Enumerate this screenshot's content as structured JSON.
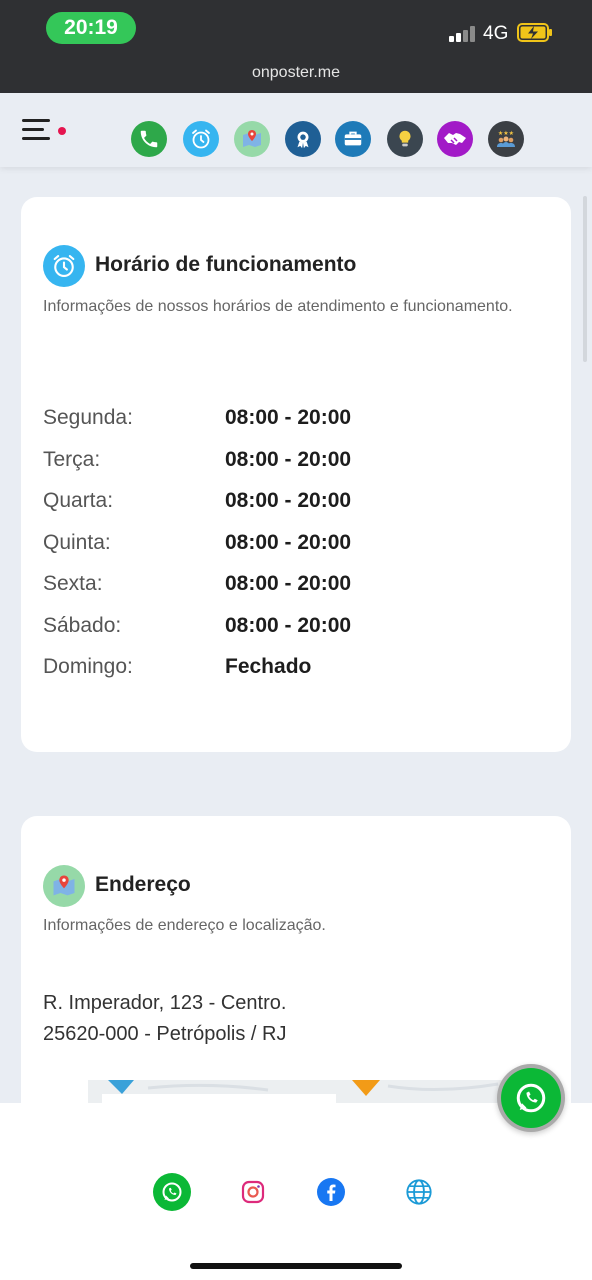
{
  "status_bar": {
    "time": "20:19",
    "network": "4G",
    "url": "onposter.me",
    "icons": [
      "signal-icon",
      "battery-charging-icon"
    ]
  },
  "header": {
    "menu_icon": "hamburger-menu-icon",
    "categories": [
      {
        "name": "phone-icon",
        "color": "#2ea84a"
      },
      {
        "name": "alarm-clock-icon",
        "color": "#36b5f0"
      },
      {
        "name": "map-pin-icon",
        "color": "#96d9a8"
      },
      {
        "name": "award-badge-icon",
        "color": "#1f5f95"
      },
      {
        "name": "briefcase-icon",
        "color": "#1e7ab8"
      },
      {
        "name": "lightbulb-icon",
        "color": "#3b4650"
      },
      {
        "name": "handshake-icon",
        "color": "#a21ac7"
      },
      {
        "name": "team-rating-icon",
        "color": "#3b3f44"
      }
    ]
  },
  "hours_card": {
    "icon": "alarm-clock-icon",
    "title": "Horário de funcionamento",
    "description": "Informações de nossos horários de atendimento e funcionamento.",
    "schedule": [
      {
        "day": "Segunda:",
        "hours": "08:00 - 20:00"
      },
      {
        "day": "Terça:",
        "hours": "08:00 - 20:00"
      },
      {
        "day": "Quarta:",
        "hours": "08:00 - 20:00"
      },
      {
        "day": "Quinta:",
        "hours": "08:00 - 20:00"
      },
      {
        "day": "Sexta:",
        "hours": "08:00 - 20:00"
      },
      {
        "day": "Sábado:",
        "hours": "08:00 - 20:00"
      },
      {
        "day": "Domingo:",
        "hours": "Fechado"
      }
    ]
  },
  "address_card": {
    "icon": "map-pin-icon",
    "title": "Endereço",
    "description": "Informações de endereço e localização.",
    "line1": "R. Imperador, 123 - Centro.",
    "line2": "25620-000 - Petrópolis / RJ"
  },
  "bottom_bar": {
    "social": [
      "whatsapp-icon",
      "instagram-icon",
      "facebook-icon",
      "globe-icon"
    ]
  },
  "fab": {
    "icon": "whatsapp-icon"
  }
}
